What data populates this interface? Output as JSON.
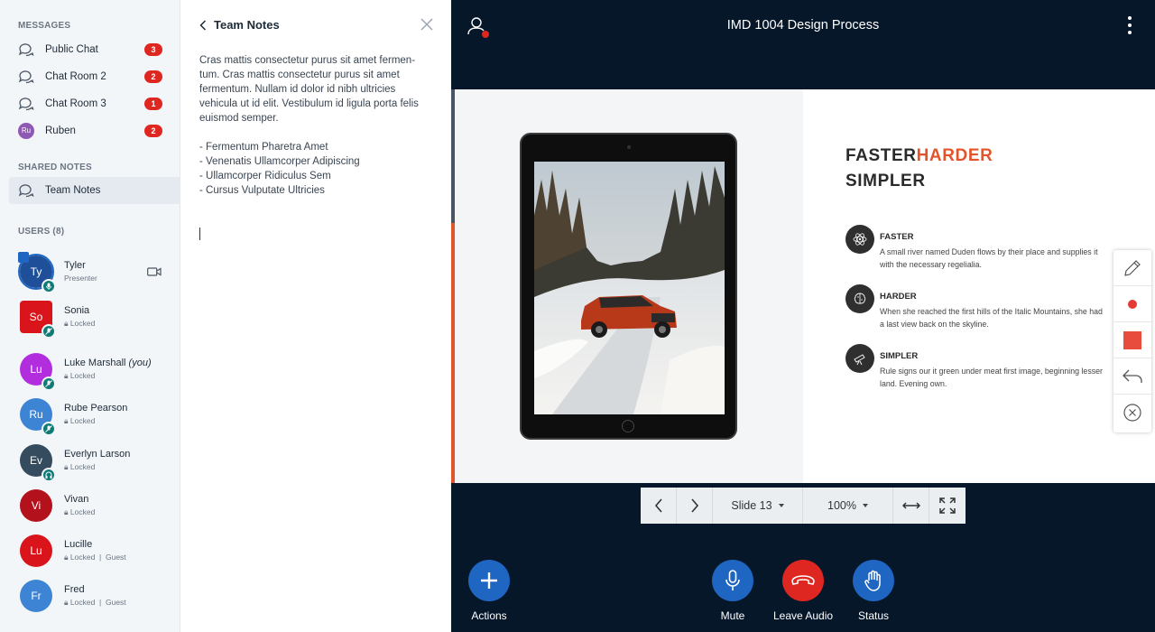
{
  "sidebar": {
    "messages_title": "MESSAGES",
    "messages": [
      {
        "label": "Public Chat",
        "badge": "3"
      },
      {
        "label": "Chat Room 2",
        "badge": "2"
      },
      {
        "label": "Chat Room 3",
        "badge": "1"
      },
      {
        "label": "Ruben",
        "badge": "2",
        "initials": "Ru"
      }
    ],
    "notes_title": "SHARED NOTES",
    "notes_item": "Team Notes",
    "users_title": "USERS (8)",
    "users": [
      {
        "initials": "Ty",
        "name": "Tyler",
        "sub": "Presenter",
        "color": "#1f4f99"
      },
      {
        "initials": "So",
        "name": "Sonia",
        "sub": "Locked",
        "color": "#d9141b"
      },
      {
        "initials": "Lu",
        "name": "Luke Marshall",
        "you": "(you)",
        "sub": "Locked",
        "color": "#b12dde"
      },
      {
        "initials": "Ru",
        "name": "Rube Pearson",
        "sub": "Locked",
        "color": "#3e84d4"
      },
      {
        "initials": "Ev",
        "name": "Everlyn Larson",
        "sub": "Locked",
        "color": "#354b5e"
      },
      {
        "initials": "Vi",
        "name": "Vivan",
        "sub": "Locked",
        "color": "#b3121c"
      },
      {
        "initials": "Lu",
        "name": "Lucille",
        "sub": "Locked",
        "guest": "Guest",
        "color": "#d9141b"
      },
      {
        "initials": "Fr",
        "name": "Fred",
        "sub": "Locked",
        "guest": "Guest",
        "color": "#3e84d4"
      }
    ]
  },
  "notes": {
    "title": "Team Notes",
    "paragraph": "Cras mattis consectetur purus sit amet fermen-tum. Cras mattis consectetur purus sit amet fermentum. Nullam id dolor id nibh ultricies vehicula ut id elit. Vestibulum id ligula porta felis euismod semper.",
    "bullets": [
      "- Fermentum Pharetra Amet",
      "- Venenatis Ullamcorper Adipiscing",
      "- Ullamcorper Ridiculus Sem",
      "- Cursus Vulputate Ultricies"
    ]
  },
  "main": {
    "title": "IMD 1004 Design Process",
    "slide": {
      "heading_a": "FASTER",
      "heading_b": "HARDER",
      "heading_c": "SIMPLER",
      "features": [
        {
          "title": "FASTER",
          "desc1": "A small river named Duden flows by their place and supplies it",
          "desc2": "with the necessary regelialia."
        },
        {
          "title": "HARDER",
          "desc1": "When she reached the first hills of the Italic Mountains, she had",
          "desc2": "a last view back on the skyline."
        },
        {
          "title": "SIMPLER",
          "desc1": "Rule signs our it green under meat first image, beginning lesser",
          "desc2": "land. Evening own."
        }
      ]
    },
    "nav": {
      "slide_label": "Slide 13",
      "zoom_label": "100%"
    },
    "actions": {
      "actions": "Actions",
      "mute": "Mute",
      "leave": "Leave Audio",
      "status": "Status"
    }
  },
  "colors": {
    "accent": "#1f66c2",
    "danger": "#df2721",
    "orange": "#e2552b",
    "bg_dark": "#06172a"
  }
}
